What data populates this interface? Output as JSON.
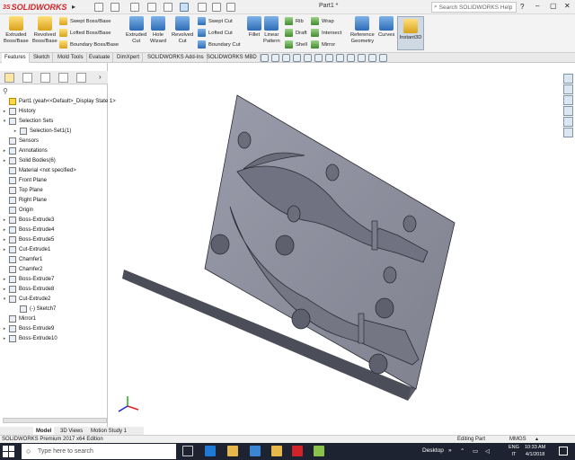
{
  "app": {
    "brand": "SOLIDWORKS",
    "ds": "3S",
    "doc_title": "Part1 *",
    "search_placeholder": "Search SOLIDWORKS Help"
  },
  "ribbon": {
    "big": [
      {
        "id": "extruded-boss",
        "label1": "Extruded",
        "label2": "Boss/Base"
      },
      {
        "id": "revolved-boss",
        "label1": "Revolved",
        "label2": "Boss/Base"
      },
      {
        "id": "extruded-cut",
        "label1": "Extruded",
        "label2": "Cut"
      },
      {
        "id": "hole-wizard",
        "label1": "Hole",
        "label2": "Wizard"
      },
      {
        "id": "revolved-cut",
        "label1": "Revolved",
        "label2": "Cut"
      },
      {
        "id": "fillet",
        "label1": "Fillet",
        "label2": ""
      },
      {
        "id": "linear-pattern",
        "label1": "Linear",
        "label2": "Pattern"
      },
      {
        "id": "reference-geometry",
        "label1": "Reference",
        "label2": "Geometry"
      },
      {
        "id": "curves",
        "label1": "Curves",
        "label2": ""
      },
      {
        "id": "instant3d",
        "label1": "Instant3D",
        "label2": ""
      }
    ],
    "small": {
      "swept_boss": "Swept Boss/Base",
      "lofted_boss": "Lofted Boss/Base",
      "boundary_boss": "Boundary Boss/Base",
      "swept_cut": "Swept Cut",
      "lofted_cut": "Lofted Cut",
      "boundary_cut": "Boundary Cut",
      "rib": "Rib",
      "draft": "Draft",
      "shell": "Shell",
      "wrap": "Wrap",
      "intersect": "Intersect",
      "mirror": "Mirror"
    }
  },
  "command_tabs": [
    "Features",
    "Sketch",
    "Mold Tools",
    "Evaluate",
    "DimXpert",
    "SOLIDWORKS Add-Ins",
    "SOLIDWORKS MBD"
  ],
  "tree": [
    {
      "exp": "",
      "label": "Part1  (yeah<<Default>_Display State 1>"
    },
    {
      "exp": "▸",
      "label": "History"
    },
    {
      "exp": "▾",
      "label": "Selection Sets"
    },
    {
      "exp": "▸",
      "label": "Selection-Set1(1)",
      "indent": 1
    },
    {
      "exp": "",
      "label": "Sensors"
    },
    {
      "exp": "▸",
      "label": "Annotations"
    },
    {
      "exp": "▸",
      "label": "Solid Bodies(6)"
    },
    {
      "exp": "",
      "label": "Material <not specified>"
    },
    {
      "exp": "",
      "label": "Front Plane"
    },
    {
      "exp": "",
      "label": "Top Plane"
    },
    {
      "exp": "",
      "label": "Right Plane"
    },
    {
      "exp": "",
      "label": "Origin"
    },
    {
      "exp": "▸",
      "label": "Boss-Extrude3"
    },
    {
      "exp": "▸",
      "label": "Boss-Extrude4"
    },
    {
      "exp": "▸",
      "label": "Boss-Extrude5"
    },
    {
      "exp": "▸",
      "label": "Cut-Extrude1"
    },
    {
      "exp": "",
      "label": "Chamfer1"
    },
    {
      "exp": "",
      "label": "Chamfer2"
    },
    {
      "exp": "▸",
      "label": "Boss-Extrude7"
    },
    {
      "exp": "▸",
      "label": "Boss-Extrude8"
    },
    {
      "exp": "▾",
      "label": "Cut-Extrude2"
    },
    {
      "exp": "",
      "label": "(-) Sketch7",
      "indent": 1
    },
    {
      "exp": "",
      "label": "Mirror1"
    },
    {
      "exp": "▸",
      "label": "Boss-Extrude9"
    },
    {
      "exp": "▸",
      "label": "Boss-Extrude10"
    }
  ],
  "bottom_tabs": [
    "Model",
    "3D Views",
    "Motion Study 1"
  ],
  "status": {
    "left": "SOLIDWORKS Premium 2017 x64 Edition",
    "mode": "Editing Part",
    "units": "MMGS"
  },
  "taskbar": {
    "search": "Type here to search",
    "desktop": "Desktop",
    "lang1": "ENG",
    "lang2": "IT",
    "time": "10:33 AM",
    "date": "4/1/2018"
  },
  "colors": {
    "model_face": "#8c8e9b",
    "model_edge": "#2a2b33",
    "brand": "#d2232a"
  }
}
